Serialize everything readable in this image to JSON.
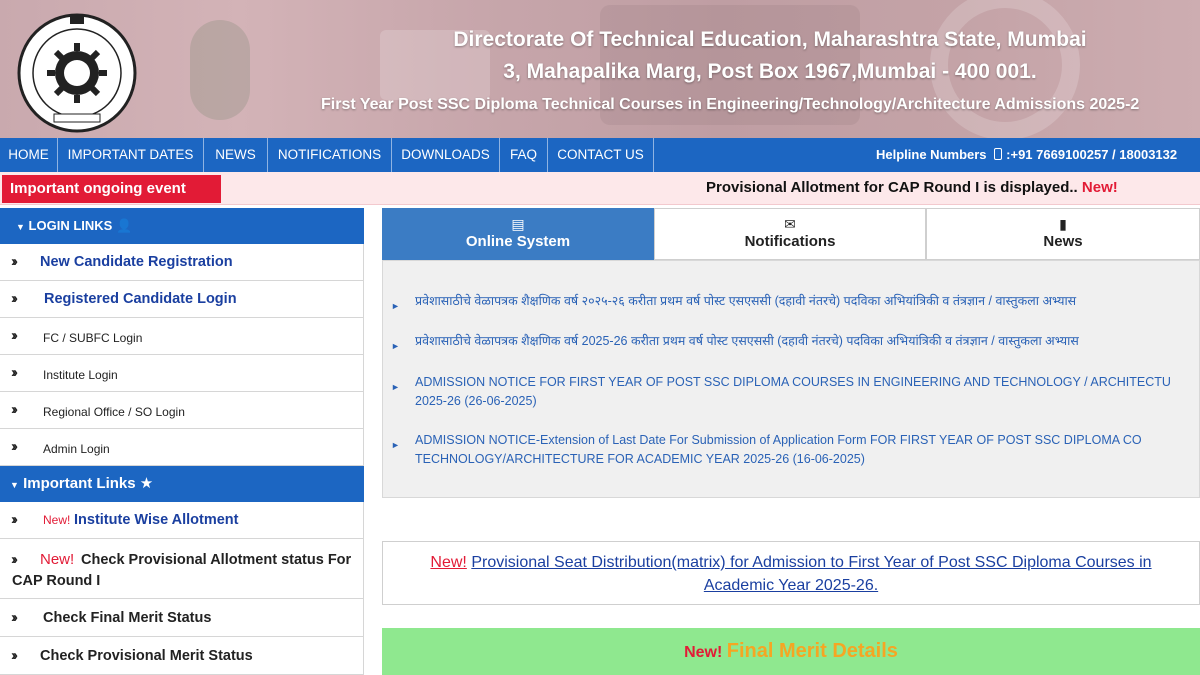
{
  "header": {
    "title_line1": "Directorate Of Technical Education, Maharashtra State, Mumbai",
    "title_line2": "3, Mahapalika Marg, Post Box 1967,Mumbai - 400 001.",
    "subtitle": "First Year Post SSC Diploma Technical Courses in Engineering/Technology/Architecture Admissions 2025-2"
  },
  "nav": {
    "items": [
      "HOME",
      "IMPORTANT DATES",
      "NEWS",
      "NOTIFICATIONS",
      "DOWNLOADS",
      "FAQ",
      "CONTACT US"
    ],
    "helpline_label": "Helpline Numbers",
    "helpline_numbers": ":+91 7669100257 / 18003132"
  },
  "ticker": {
    "tag": "Important ongoing event",
    "message": "Provisional Allotment for CAP Round I is displayed..",
    "new_label": "New!"
  },
  "sidebar": {
    "login_heading": "LOGIN LINKS",
    "login_items": [
      "New Candidate Registration",
      "Registered Candidate Login",
      "FC / SUBFC Login",
      "Institute Login",
      "Regional Office / SO Login",
      "Admin Login"
    ],
    "links_heading": "Important Links",
    "links_items": [
      {
        "new": "New!",
        "label": "Institute Wise Allotment"
      },
      {
        "new": "New!",
        "label": "Check Provisional Allotment status For",
        "label2": "CAP Round I"
      },
      {
        "label": "Check Final Merit Status"
      },
      {
        "label": "Check Provisional Merit Status"
      }
    ]
  },
  "tabs": [
    {
      "label": "Online System",
      "icon": "list-icon",
      "active": true
    },
    {
      "label": "Notifications",
      "icon": "envelope-icon",
      "active": false
    },
    {
      "label": "News",
      "icon": "file-icon",
      "active": false
    }
  ],
  "notices": [
    {
      "line1": "प्रवेशासाठीचे वेळापत्रक शैक्षणिक वर्ष २०२५-२६ करीता प्रथम वर्ष पोस्ट एसएससी (दहावी नंतरचे) पदविका अभियांत्रिकी व तंत्रज्ञान / वास्तुकला अभ्यास"
    },
    {
      "line1": "प्रवेशासाठीचे वेळापत्रक शैक्षणिक वर्ष 2025-26 करीता प्रथम वर्ष पोस्ट एसएससी (दहावी नंतरचे) पदविका अभियांत्रिकी व तंत्रज्ञान / वास्तुकला अभ्यास"
    },
    {
      "line1": "ADMISSION NOTICE FOR FIRST YEAR OF POST SSC DIPLOMA COURSES IN ENGINEERING AND TECHNOLOGY / ARCHITECTU",
      "line2": "2025-26 (26-06-2025)"
    },
    {
      "line1": "ADMISSION NOTICE-Extension of Last Date For Submission of Application Form FOR FIRST YEAR OF POST SSC DIPLOMA CO",
      "line2": "TECHNOLOGY/ARCHITECTURE FOR ACADEMIC YEAR 2025-26 (16-06-2025)"
    }
  ],
  "seat_box": {
    "new_label": "New!",
    "line1": "Provisional Seat Distribution(matrix) for Admission to First Year of Post SSC Diploma Courses in",
    "line2": "Academic Year 2025-26."
  },
  "merit_box": {
    "new_label": "New!",
    "title": "Final Merit Details"
  },
  "colors": {
    "nav_blue": "#1c66c2",
    "tag_red": "#e21b36",
    "tab_active": "#3b7cc4",
    "link_blue": "#1a3fa0",
    "merit_green": "#8fe88f",
    "merit_orange": "#f5a623"
  }
}
